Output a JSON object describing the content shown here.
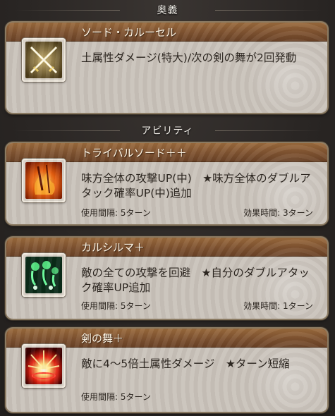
{
  "sections": {
    "ougi_label": "奥義",
    "ability_label": "アビリティ"
  },
  "ougi": {
    "name": "ソード・カルーセル",
    "description": "土属性ダメージ(特大)/次の剣の舞が2回発動",
    "icon": "crossed-swords-icon"
  },
  "abilities": [
    {
      "name": "トライバルソード＋＋",
      "description": "味方全体の攻撃UP(中)　★味方全体のダブルアタック確率UP(中)追加",
      "cooldown": "使用間隔: 5ターン",
      "duration": "効果時間: 3ターン",
      "icon": "tribal-flame-icon"
    },
    {
      "name": "カルシルマ＋",
      "description": "敵の全ての攻撃を回避　★自分のダブルアタック確率UP追加",
      "cooldown": "使用間隔: 5ターン",
      "duration": "効果時間: 1ターン",
      "icon": "green-spirits-icon"
    },
    {
      "name": "剣の舞＋",
      "description": "敵に4〜5倍土属性ダメージ　★ターン短縮",
      "cooldown": "使用間隔: 5ターン",
      "icon": "red-burst-icon"
    }
  ]
}
